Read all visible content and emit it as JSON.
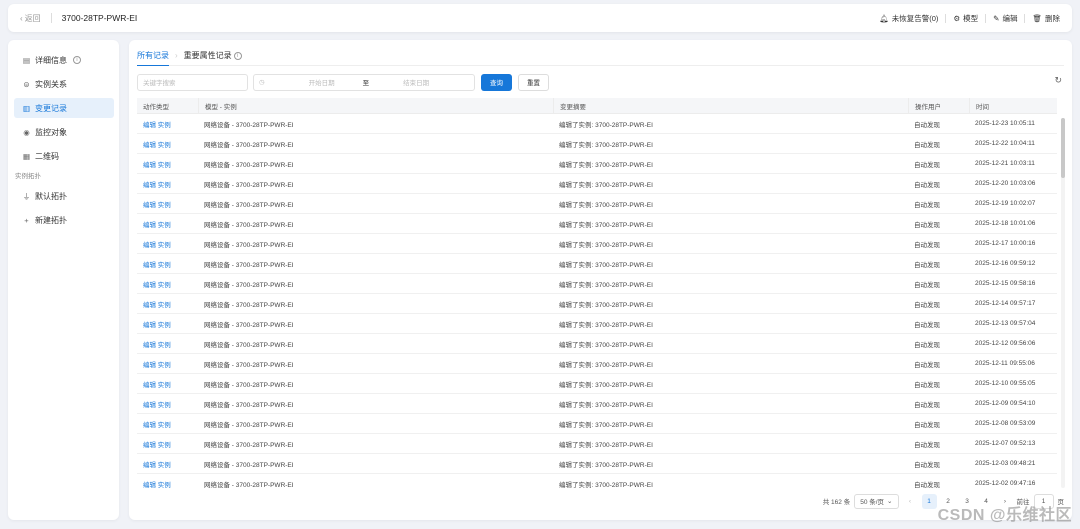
{
  "topbar": {
    "back_label": "返回",
    "title": "3700-28TP-PWR-EI",
    "alarm_label": "未恢复告警(0)",
    "model_label": "模型",
    "edit_label": "编辑",
    "delete_label": "删除"
  },
  "sidebar": {
    "items": [
      {
        "label": "详细信息",
        "icon": "document-icon"
      },
      {
        "label": "实例关系",
        "icon": "link-icon"
      },
      {
        "label": "变更记录",
        "icon": "history-icon"
      },
      {
        "label": "监控对象",
        "icon": "monitor-icon"
      },
      {
        "label": "二维码",
        "icon": "qrcode-icon"
      }
    ],
    "group_label": "实例拓扑",
    "topo_items": [
      {
        "label": "默认拓扑",
        "icon": "topology-icon"
      },
      {
        "label": "新建拓扑",
        "icon": "plus-icon"
      }
    ]
  },
  "main": {
    "tabs": [
      {
        "label": "所有记录",
        "active": true
      },
      {
        "label": "重要属性记录",
        "active": false
      }
    ],
    "filters": {
      "keyword_placeholder": "关键字搜索",
      "start_placeholder": "开始日期",
      "range_sep": "至",
      "end_placeholder": "结束日期",
      "search_label": "查询",
      "reset_label": "重置"
    },
    "table": {
      "columns": [
        "动作类型",
        "模型 - 实例",
        "变更摘要",
        "操作用户",
        "时间"
      ],
      "rows": [
        {
          "action": "编辑 实例",
          "model": "网络设备 - 3700-28TP-PWR-EI",
          "summary": "编辑了实例: 3700-28TP-PWR-EI",
          "user": "自动发现",
          "time": "2025-12-23 10:05:11"
        },
        {
          "action": "编辑 实例",
          "model": "网络设备 - 3700-28TP-PWR-EI",
          "summary": "编辑了实例: 3700-28TP-PWR-EI",
          "user": "自动发现",
          "time": "2025-12-22 10:04:11"
        },
        {
          "action": "编辑 实例",
          "model": "网络设备 - 3700-28TP-PWR-EI",
          "summary": "编辑了实例: 3700-28TP-PWR-EI",
          "user": "自动发现",
          "time": "2025-12-21 10:03:11"
        },
        {
          "action": "编辑 实例",
          "model": "网络设备 - 3700-28TP-PWR-EI",
          "summary": "编辑了实例: 3700-28TP-PWR-EI",
          "user": "自动发现",
          "time": "2025-12-20 10:03:06"
        },
        {
          "action": "编辑 实例",
          "model": "网络设备 - 3700-28TP-PWR-EI",
          "summary": "编辑了实例: 3700-28TP-PWR-EI",
          "user": "自动发现",
          "time": "2025-12-19 10:02:07"
        },
        {
          "action": "编辑 实例",
          "model": "网络设备 - 3700-28TP-PWR-EI",
          "summary": "编辑了实例: 3700-28TP-PWR-EI",
          "user": "自动发现",
          "time": "2025-12-18 10:01:06"
        },
        {
          "action": "编辑 实例",
          "model": "网络设备 - 3700-28TP-PWR-EI",
          "summary": "编辑了实例: 3700-28TP-PWR-EI",
          "user": "自动发现",
          "time": "2025-12-17 10:00:16"
        },
        {
          "action": "编辑 实例",
          "model": "网络设备 - 3700-28TP-PWR-EI",
          "summary": "编辑了实例: 3700-28TP-PWR-EI",
          "user": "自动发现",
          "time": "2025-12-16 09:59:12"
        },
        {
          "action": "编辑 实例",
          "model": "网络设备 - 3700-28TP-PWR-EI",
          "summary": "编辑了实例: 3700-28TP-PWR-EI",
          "user": "自动发现",
          "time": "2025-12-15 09:58:16"
        },
        {
          "action": "编辑 实例",
          "model": "网络设备 - 3700-28TP-PWR-EI",
          "summary": "编辑了实例: 3700-28TP-PWR-EI",
          "user": "自动发现",
          "time": "2025-12-14 09:57:17"
        },
        {
          "action": "编辑 实例",
          "model": "网络设备 - 3700-28TP-PWR-EI",
          "summary": "编辑了实例: 3700-28TP-PWR-EI",
          "user": "自动发现",
          "time": "2025-12-13 09:57:04"
        },
        {
          "action": "编辑 实例",
          "model": "网络设备 - 3700-28TP-PWR-EI",
          "summary": "编辑了实例: 3700-28TP-PWR-EI",
          "user": "自动发现",
          "time": "2025-12-12 09:56:06"
        },
        {
          "action": "编辑 实例",
          "model": "网络设备 - 3700-28TP-PWR-EI",
          "summary": "编辑了实例: 3700-28TP-PWR-EI",
          "user": "自动发现",
          "time": "2025-12-11 09:55:06"
        },
        {
          "action": "编辑 实例",
          "model": "网络设备 - 3700-28TP-PWR-EI",
          "summary": "编辑了实例: 3700-28TP-PWR-EI",
          "user": "自动发现",
          "time": "2025-12-10 09:55:05"
        },
        {
          "action": "编辑 实例",
          "model": "网络设备 - 3700-28TP-PWR-EI",
          "summary": "编辑了实例: 3700-28TP-PWR-EI",
          "user": "自动发现",
          "time": "2025-12-09 09:54:10"
        },
        {
          "action": "编辑 实例",
          "model": "网络设备 - 3700-28TP-PWR-EI",
          "summary": "编辑了实例: 3700-28TP-PWR-EI",
          "user": "自动发现",
          "time": "2025-12-08 09:53:09"
        },
        {
          "action": "编辑 实例",
          "model": "网络设备 - 3700-28TP-PWR-EI",
          "summary": "编辑了实例: 3700-28TP-PWR-EI",
          "user": "自动发现",
          "time": "2025-12-07 09:52:13"
        },
        {
          "action": "编辑 实例",
          "model": "网络设备 - 3700-28TP-PWR-EI",
          "summary": "编辑了实例: 3700-28TP-PWR-EI",
          "user": "自动发现",
          "time": "2025-12-03 09:48:21"
        },
        {
          "action": "编辑 实例",
          "model": "网络设备 - 3700-28TP-PWR-EI",
          "summary": "编辑了实例: 3700-28TP-PWR-EI",
          "user": "自动发现",
          "time": "2025-12-02 09:47:16"
        }
      ]
    },
    "pagination": {
      "total_label": "共 162 条",
      "page_size_label": "50 条/页",
      "pages": [
        "1",
        "2",
        "3",
        "4"
      ],
      "current": "1",
      "goto_label": "前往",
      "goto_value": "1",
      "page_suffix": "页"
    }
  },
  "watermark": "CSDN @乐维社区",
  "colors": {
    "accent": "#1677d9",
    "background": "#f0f2f7"
  }
}
